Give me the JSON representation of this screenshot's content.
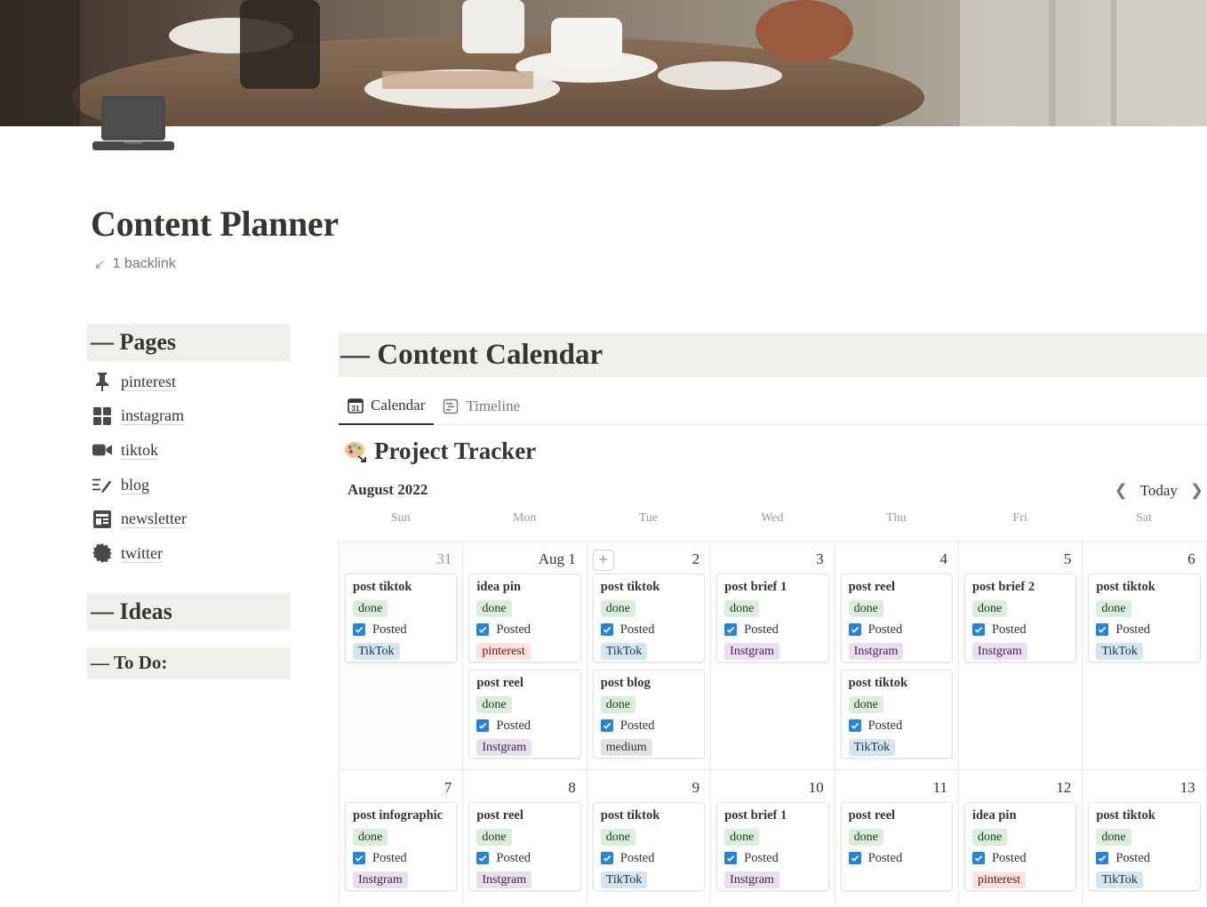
{
  "page": {
    "title": "Content Planner",
    "backlink": "1 backlink"
  },
  "sidebar": {
    "pages_heading": "— Pages",
    "items": [
      {
        "label": "pinterest",
        "icon": "pushpin-icon"
      },
      {
        "label": "instagram",
        "icon": "grid-icon"
      },
      {
        "label": "tiktok",
        "icon": "video-camera-icon"
      },
      {
        "label": "blog",
        "icon": "text-write-icon"
      },
      {
        "label": "newsletter",
        "icon": "newspaper-icon"
      },
      {
        "label": "twitter",
        "icon": "badge-icon"
      }
    ],
    "ideas_heading": "— Ideas",
    "todo_heading": "— To Do:"
  },
  "calendar_section": {
    "heading": "— Content Calendar",
    "tabs": [
      {
        "label": "Calendar",
        "icon": "calendar-icon",
        "active": true
      },
      {
        "label": "Timeline",
        "icon": "timeline-icon",
        "active": false
      }
    ],
    "database_title": "Project Tracker",
    "month": "August 2022",
    "today_label": "Today",
    "weekdays": [
      "Sun",
      "Mon",
      "Tue",
      "Wed",
      "Thu",
      "Fri",
      "Sat"
    ],
    "colors": {
      "done": "#dbeddb",
      "tiktok": "#d3e5ef",
      "pinterest": "#ffe2dd",
      "instgram": "#e8deee",
      "medium": "#e3e2e0",
      "checkbox": "#2383e2",
      "header_bg": "#eef1ea"
    },
    "weeks": [
      [
        {
          "date": "31",
          "muted": true,
          "cards": [
            {
              "name": "post tiktok",
              "status": "done",
              "check": "Posted",
              "platform": "TikTok",
              "ptype": "tiktok"
            }
          ]
        },
        {
          "date": "Aug 1",
          "cards": [
            {
              "name": "idea pin",
              "status": "done",
              "check": "Posted",
              "platform": "pinterest",
              "ptype": "pinterest"
            },
            {
              "name": "post reel",
              "status": "done",
              "check": "Posted",
              "platform": "Instgram",
              "ptype": "instgram"
            }
          ]
        },
        {
          "date": "2",
          "add": true,
          "cards": [
            {
              "name": "post tiktok",
              "status": "done",
              "check": "Posted",
              "platform": "TikTok",
              "ptype": "tiktok"
            },
            {
              "name": "post blog",
              "status": "done",
              "check": "Posted",
              "platform": "medium",
              "ptype": "medium"
            }
          ]
        },
        {
          "date": "3",
          "cards": [
            {
              "name": "post brief 1",
              "status": "done",
              "check": "Posted",
              "platform": "Instgram",
              "ptype": "instgram"
            }
          ]
        },
        {
          "date": "4",
          "cards": [
            {
              "name": "post reel",
              "status": "done",
              "check": "Posted",
              "platform": "Instgram",
              "ptype": "instgram"
            },
            {
              "name": "post tiktok",
              "status": "done",
              "check": "Posted",
              "platform": "TikTok",
              "ptype": "tiktok"
            }
          ]
        },
        {
          "date": "5",
          "cards": [
            {
              "name": "post brief 2",
              "status": "done",
              "check": "Posted",
              "platform": "Instgram",
              "ptype": "instgram"
            }
          ]
        },
        {
          "date": "6",
          "cards": [
            {
              "name": "post tiktok",
              "status": "done",
              "check": "Posted",
              "platform": "TikTok",
              "ptype": "tiktok"
            }
          ]
        }
      ],
      [
        {
          "date": "7",
          "cards": [
            {
              "name": "post infographic",
              "status": "done",
              "check": "Posted",
              "platform": "Instgram",
              "ptype": "instgram"
            }
          ]
        },
        {
          "date": "8",
          "cards": [
            {
              "name": "post reel",
              "status": "done",
              "check": "Posted",
              "platform": "Instgram",
              "ptype": "instgram"
            }
          ]
        },
        {
          "date": "9",
          "cards": [
            {
              "name": "post tiktok",
              "status": "done",
              "check": "Posted",
              "platform": "TikTok",
              "ptype": "tiktok"
            }
          ]
        },
        {
          "date": "10",
          "cards": [
            {
              "name": "post brief 1",
              "status": "done",
              "check": "Posted",
              "platform": "Instgram",
              "ptype": "instgram"
            }
          ]
        },
        {
          "date": "11",
          "cards": [
            {
              "name": "post reel",
              "status": "done",
              "check": "Posted",
              "platform": "",
              "ptype": ""
            }
          ]
        },
        {
          "date": "12",
          "cards": [
            {
              "name": "idea pin",
              "status": "done",
              "check": "Posted",
              "platform": "pinterest",
              "ptype": "pinterest"
            }
          ]
        },
        {
          "date": "13",
          "cards": [
            {
              "name": "post tiktok",
              "status": "done",
              "check": "Posted",
              "platform": "TikTok",
              "ptype": "tiktok"
            }
          ]
        }
      ]
    ]
  }
}
